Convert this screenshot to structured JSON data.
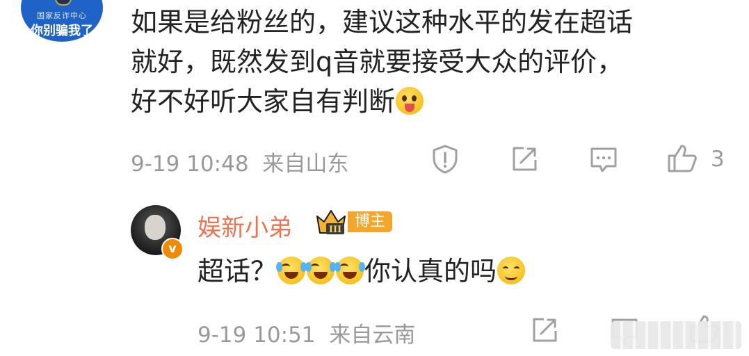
{
  "avatar_top": {
    "org": "国家反诈中心",
    "slogan": "你别骗我了"
  },
  "comment": {
    "lines": [
      "如果是给粉丝的，建议这种水平的发在超话",
      "就好，既然发到q音就要接受大众的评价，",
      "好不好听大家自有判断"
    ],
    "time": "9-19 10:48",
    "location": "来自山东",
    "like_count": "3"
  },
  "reply": {
    "name": "娱新小弟",
    "badge": "博主",
    "crown_level": "III",
    "verified_mark": "v",
    "text_start": "超话？",
    "text_end": "你认真的吗",
    "time": "9-19 10:51",
    "location": "来自云南"
  },
  "colors": {
    "name": "#eb7350",
    "meta": "#999999",
    "badge": "#f3a62c",
    "avatar_top_bg": "#1f63c8"
  }
}
